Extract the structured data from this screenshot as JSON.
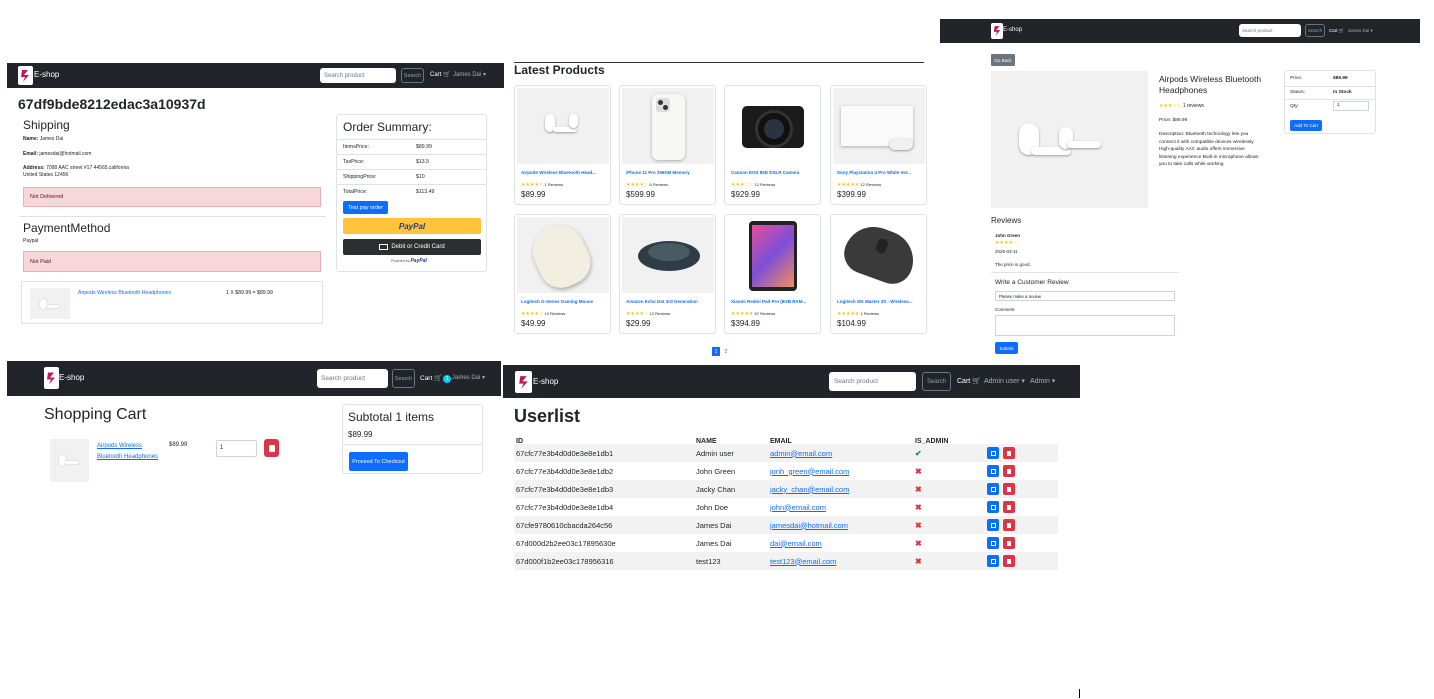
{
  "navbar": {
    "brand": "E-shop",
    "search_placeholder": "Search product",
    "search_button": "Search",
    "cart_label": "Cart",
    "user_name": "James Dai",
    "admin_user": "Admin user",
    "admin_menu": "Admin",
    "cart_badge": "1"
  },
  "order": {
    "id": "67df9bde8212edac3a10937d",
    "shipping_heading": "Shipping",
    "name_label": "Name:",
    "name_value": "James Dai",
    "email_label": "Email:",
    "email_value": "jamesdai@hotmail.com",
    "address_label": "Address:",
    "address_value": "7098 AAC street #17 44565,california",
    "address_line2": "United States 12456",
    "delivery_status": "Not Delivered",
    "payment_heading": "PaymentMethod",
    "payment_value": "Paypal",
    "paid_status": "Not Paid",
    "item_name": "Airpods Wireless Bluetooth Headphones",
    "item_calc": "1 X $89.99 = $89.99",
    "summary": {
      "title": "Order Summary:",
      "rows": [
        {
          "label": "ItemsPrice:",
          "value": "$89.99"
        },
        {
          "label": "TaxPrice:",
          "value": "$13.5"
        },
        {
          "label": "ShippingPrice:",
          "value": "$10"
        },
        {
          "label": "TotalPrice:",
          "value": "$113.49"
        }
      ],
      "test_button": "Test pay order",
      "paypal_label": "PayPal",
      "card_label": "Debit or Credit Card",
      "powered_by": "Powered by",
      "powered_brand": "PayPal"
    }
  },
  "latest": {
    "title": "Latest Products",
    "products": [
      {
        "name": "Airpods Wireless Bluetooth Head...",
        "reviews": "1 Reviews",
        "price": "$89.99",
        "rating": 3.5
      },
      {
        "name": "iPhone 11 Pro 256GB Memory",
        "reviews": "8 Reviews",
        "price": "$599.99",
        "rating": 4
      },
      {
        "name": "Cannon EOS 80D DSLR Camera",
        "reviews": "12 Reviews",
        "price": "$929.99",
        "rating": 3
      },
      {
        "name": "Sony Playstation 4 Pro White Ver...",
        "reviews": "12 Reviews",
        "price": "$399.99",
        "rating": 5
      },
      {
        "name": "Logitech G-Series Gaming Mouse",
        "reviews": "10 Reviews",
        "price": "$49.99",
        "rating": 3.5
      },
      {
        "name": "Amazon Echo Dot 3rd Generation",
        "reviews": "12 Reviews",
        "price": "$29.99",
        "rating": 4
      },
      {
        "name": "Xiaomi Redmi Pad Pro (8GB RAM...",
        "reviews": "67 Reviews",
        "price": "$394.89",
        "rating": 4.5
      },
      {
        "name": "Logitech MX Master 3S - Wireless...",
        "reviews": "1 Reviews",
        "price": "$104.99",
        "rating": 5
      }
    ],
    "pages": [
      "1",
      "2"
    ]
  },
  "product_detail": {
    "go_back": "Go Back",
    "title": "Airpods Wireless Bluetooth Headphones",
    "reviews_count": "1 reviews",
    "price_line": "Price: $89.99",
    "description": "Description: Bluetooth technology lets you connect it with compatible devices wirelessly High-quality AAC audio offers immersive listening experience Built-in microphone allows you to take calls while working",
    "price_label": "Price:",
    "price_value": "$89.99",
    "status_label": "Status:",
    "status_value": "In Stock",
    "qty_label": "Qty:",
    "qty_value": "1",
    "add_button": "Add To Cart",
    "reviews_heading": "Reviews",
    "review_author": "John Green",
    "review_date": "2025-03-11",
    "review_text": "The price is good.",
    "write_heading": "Write a Customer Review",
    "rating_select": "Please make a review",
    "comment_label": "Comment",
    "submit": "Submit"
  },
  "cart": {
    "title": "Shopping Cart",
    "item_name": "Airpods Wireless Bluetooth Headphones",
    "item_price": "$89.99",
    "qty": "1",
    "subtotal_title": "Subtotal 1 items",
    "subtotal_value": "$89.99",
    "checkout": "Proceed To Checkout"
  },
  "userlist": {
    "title": "Userlist",
    "columns": [
      "ID",
      "NAME",
      "EMAIL",
      "IS_ADMIN"
    ],
    "rows": [
      {
        "id": "67cfc77e3b4d0d0e3e8e1db1",
        "name": "Admin user",
        "email": "admin@email.com",
        "admin": true
      },
      {
        "id": "67cfc77e3b4d0d0e3e8e1db2",
        "name": "John Green",
        "email": "jonh_green@email.com",
        "admin": false
      },
      {
        "id": "67cfc77e3b4d0d0e3e8e1db3",
        "name": "Jacky Chan",
        "email": "jacky_chan@email.com",
        "admin": false
      },
      {
        "id": "67cfc77e3b4d0d0e3e8e1db4",
        "name": "John Doe",
        "email": "john@email.com",
        "admin": false
      },
      {
        "id": "67cfe9780610cbacda264c56",
        "name": "James Dai",
        "email": "jamesdai@hotmail.com",
        "admin": false
      },
      {
        "id": "67d000d2b2ee03c17895630e",
        "name": "James Dai",
        "email": "dai@email.com",
        "admin": false
      },
      {
        "id": "67d000f1b2ee03c178956316",
        "name": "test123",
        "email": "test123@email.com",
        "admin": false
      }
    ]
  },
  "colors": {
    "navbar": "#212529",
    "primary": "#0d6efd",
    "danger": "#dc3545",
    "star": "#f8c10e",
    "paypal": "#ffc439"
  }
}
